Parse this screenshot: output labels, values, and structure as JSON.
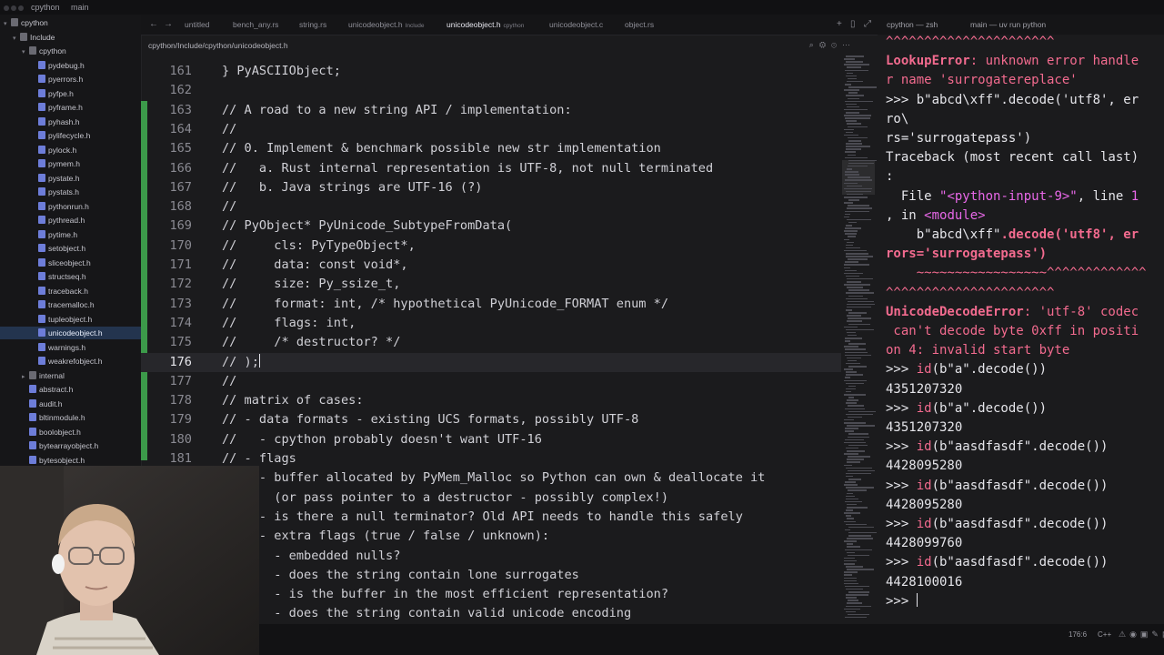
{
  "topbar": {
    "app": "cpython",
    "branch": "main"
  },
  "sidebar": {
    "items": [
      {
        "label": "cpython",
        "depth": 0,
        "kind": "root"
      },
      {
        "label": "Include",
        "depth": 1,
        "kind": "folder"
      },
      {
        "label": "cpython",
        "depth": 2,
        "kind": "folder"
      },
      {
        "label": "pydebug.h",
        "depth": 3,
        "kind": "file"
      },
      {
        "label": "pyerrors.h",
        "depth": 3,
        "kind": "file"
      },
      {
        "label": "pyfpe.h",
        "depth": 3,
        "kind": "file"
      },
      {
        "label": "pyframe.h",
        "depth": 3,
        "kind": "file"
      },
      {
        "label": "pyhash.h",
        "depth": 3,
        "kind": "file"
      },
      {
        "label": "pylifecycle.h",
        "depth": 3,
        "kind": "file"
      },
      {
        "label": "pylock.h",
        "depth": 3,
        "kind": "file"
      },
      {
        "label": "pymem.h",
        "depth": 3,
        "kind": "file"
      },
      {
        "label": "pystate.h",
        "depth": 3,
        "kind": "file"
      },
      {
        "label": "pystats.h",
        "depth": 3,
        "kind": "file"
      },
      {
        "label": "pythonrun.h",
        "depth": 3,
        "kind": "file"
      },
      {
        "label": "pythread.h",
        "depth": 3,
        "kind": "file"
      },
      {
        "label": "pytime.h",
        "depth": 3,
        "kind": "file"
      },
      {
        "label": "setobject.h",
        "depth": 3,
        "kind": "file"
      },
      {
        "label": "sliceobject.h",
        "depth": 3,
        "kind": "file"
      },
      {
        "label": "structseq.h",
        "depth": 3,
        "kind": "file"
      },
      {
        "label": "traceback.h",
        "depth": 3,
        "kind": "file"
      },
      {
        "label": "tracemalloc.h",
        "depth": 3,
        "kind": "file"
      },
      {
        "label": "tupleobject.h",
        "depth": 3,
        "kind": "file"
      },
      {
        "label": "unicodeobject.h",
        "depth": 3,
        "kind": "file",
        "selected": true
      },
      {
        "label": "warnings.h",
        "depth": 3,
        "kind": "file"
      },
      {
        "label": "weakrefobject.h",
        "depth": 3,
        "kind": "file"
      },
      {
        "label": "internal",
        "depth": 2,
        "kind": "folder"
      },
      {
        "label": "abstract.h",
        "depth": 2,
        "kind": "file"
      },
      {
        "label": "audit.h",
        "depth": 2,
        "kind": "file"
      },
      {
        "label": "bltinmodule.h",
        "depth": 2,
        "kind": "file"
      },
      {
        "label": "boolobject.h",
        "depth": 2,
        "kind": "file"
      },
      {
        "label": "bytearrayobject.h",
        "depth": 2,
        "kind": "file"
      },
      {
        "label": "bytesobject.h",
        "depth": 2,
        "kind": "file"
      }
    ]
  },
  "tabs": [
    {
      "label": "untitled",
      "sub": ""
    },
    {
      "label": "bench_any.rs",
      "sub": ""
    },
    {
      "label": "string.rs",
      "sub": ""
    },
    {
      "label": "unicodeobject.h",
      "sub": "Include"
    },
    {
      "label": "unicodeobject.h",
      "sub": "cpython",
      "active": true
    },
    {
      "label": "unicodeobject.c",
      "sub": ""
    },
    {
      "label": "object.rs",
      "sub": ""
    }
  ],
  "breadcrumb": "cpython/Include/cpython/unicodeobject.h",
  "editor": {
    "lines": [
      {
        "n": "161",
        "t": "} PyASCIIObject;"
      },
      {
        "n": "162",
        "t": ""
      },
      {
        "n": "163",
        "t": "// A road to a new string API / implementation:"
      },
      {
        "n": "164",
        "t": "//"
      },
      {
        "n": "165",
        "t": "// 0. Implement & benchmark possible new str implementation"
      },
      {
        "n": "166",
        "t": "//   a. Rust internal representation is UTF-8, not null terminated"
      },
      {
        "n": "167",
        "t": "//   b. Java strings are UTF-16 (?)"
      },
      {
        "n": "168",
        "t": "//"
      },
      {
        "n": "169",
        "t": "// PyObject* PyUnicode_SubtypeFromData("
      },
      {
        "n": "170",
        "t": "//     cls: PyTypeObject*,"
      },
      {
        "n": "171",
        "t": "//     data: const void*,"
      },
      {
        "n": "172",
        "t": "//     size: Py_ssize_t,"
      },
      {
        "n": "173",
        "t": "//     format: int, /* hypothetical PyUnicode_FORMAT enum */"
      },
      {
        "n": "174",
        "t": "//     flags: int,"
      },
      {
        "n": "175",
        "t": "//     /* destructor? */"
      },
      {
        "n": "176",
        "t": "// );",
        "current": true
      },
      {
        "n": "177",
        "t": "//"
      },
      {
        "n": "178",
        "t": "// matrix of cases:"
      },
      {
        "n": "179",
        "t": "// - data formats - existing UCS formats, possibly UTF-8"
      },
      {
        "n": "180",
        "t": "//   - cpython probably doesn't want UTF-16"
      },
      {
        "n": "181",
        "t": "// - flags"
      },
      {
        "n": "",
        "t": "     - buffer allocated by PyMem_Malloc so Python can own & deallocate it"
      },
      {
        "n": "",
        "t": "       (or pass pointer to a destructor - possibly complex!)"
      },
      {
        "n": "",
        "t": "     - is there a null terminator? Old API needs to handle this safely"
      },
      {
        "n": "",
        "t": "     - extra flags (true / false / unknown):"
      },
      {
        "n": "",
        "t": "       - embedded nulls?"
      },
      {
        "n": "",
        "t": "       - does the string contain lone surrogates"
      },
      {
        "n": "",
        "t": "       - is the buffer in the most efficient representation?"
      },
      {
        "n": "",
        "t": "       - does the string contain valid unicode encoding"
      }
    ]
  },
  "terminal": {
    "tabs": [
      "cpython — zsh",
      "main — uv run python"
    ],
    "lines": [
      [
        {
          "c": "red",
          "t": "^^^^^^^^^^^^^^^^^^^^^^"
        }
      ],
      [
        {
          "c": "redb",
          "t": "LookupError"
        },
        {
          "c": "red",
          "t": ": unknown error handle"
        }
      ],
      [
        {
          "c": "red",
          "t": "r name 'surrogatereplace'"
        }
      ],
      [
        {
          "c": "prompt",
          "t": ">>> b\"abcd\\xff\".decode('utf8', er"
        }
      ],
      [
        {
          "c": "prompt",
          "t": "ro\\"
        }
      ],
      [
        {
          "c": "prompt",
          "t": "rs='surrogatepass')"
        }
      ],
      [
        {
          "c": "prompt",
          "t": "Traceback (most recent call last)"
        }
      ],
      [
        {
          "c": "prompt",
          "t": ":"
        }
      ],
      [
        {
          "c": "prompt",
          "t": "  File "
        },
        {
          "c": "magenta",
          "t": "\"<python-input-9>\""
        },
        {
          "c": "prompt",
          "t": ", line "
        },
        {
          "c": "magenta",
          "t": "1"
        }
      ],
      [
        {
          "c": "prompt",
          "t": ", in "
        },
        {
          "c": "magenta",
          "t": "<module>"
        }
      ],
      [
        {
          "c": "prompt",
          "t": "    b\"abcd\\xff\""
        },
        {
          "c": "redb",
          "t": ".decode('utf8', er"
        }
      ],
      [
        {
          "c": "redb",
          "t": "rors='surrogatepass')"
        }
      ],
      [
        {
          "c": "red",
          "t": "    ~~~~~~~~~~~~~~~~~^^^^^^^^^^^^^"
        }
      ],
      [
        {
          "c": "red",
          "t": "^^^^^^^^^^^^^^^^^^^^^^"
        }
      ],
      [
        {
          "c": "redb",
          "t": "UnicodeDecodeError"
        },
        {
          "c": "red",
          "t": ": 'utf-8' codec"
        }
      ],
      [
        {
          "c": "red",
          "t": " can't decode byte 0xff in positi"
        }
      ],
      [
        {
          "c": "red",
          "t": "on 4: invalid start byte"
        }
      ],
      [
        {
          "c": "prompt",
          "t": ">>> "
        },
        {
          "c": "red",
          "t": "id"
        },
        {
          "c": "prompt",
          "t": "(b\"a\".decode())"
        }
      ],
      [
        {
          "c": "prompt",
          "t": "4351207320"
        }
      ],
      [
        {
          "c": "prompt",
          "t": ">>> "
        },
        {
          "c": "red",
          "t": "id"
        },
        {
          "c": "prompt",
          "t": "(b\"a\".decode())"
        }
      ],
      [
        {
          "c": "prompt",
          "t": "4351207320"
        }
      ],
      [
        {
          "c": "prompt",
          "t": ">>> "
        },
        {
          "c": "red",
          "t": "id"
        },
        {
          "c": "prompt",
          "t": "(b\"aasdfasdf\".decode())"
        }
      ],
      [
        {
          "c": "prompt",
          "t": "4428095280"
        }
      ],
      [
        {
          "c": "prompt",
          "t": ">>> "
        },
        {
          "c": "red",
          "t": "id"
        },
        {
          "c": "prompt",
          "t": "(b\"aasdfasdf\".decode())"
        }
      ],
      [
        {
          "c": "prompt",
          "t": "4428095280"
        }
      ],
      [
        {
          "c": "prompt",
          "t": ">>> "
        },
        {
          "c": "red",
          "t": "id"
        },
        {
          "c": "prompt",
          "t": "(b\"aasdfasdf\".decode())"
        }
      ],
      [
        {
          "c": "prompt",
          "t": "4428099760"
        }
      ],
      [
        {
          "c": "prompt",
          "t": ">>> "
        },
        {
          "c": "red",
          "t": "id"
        },
        {
          "c": "prompt",
          "t": "(b\"aasdfasdf\".decode())"
        }
      ],
      [
        {
          "c": "prompt",
          "t": "4428100016"
        }
      ],
      [
        {
          "c": "prompt",
          "t": ">>> "
        }
      ]
    ]
  },
  "status": {
    "position": "176:6",
    "language": "C++"
  },
  "colors": {
    "accent": "#3c9a4a",
    "selection": "#23344e",
    "error": "#f36b8f",
    "string": "#e868e8"
  }
}
